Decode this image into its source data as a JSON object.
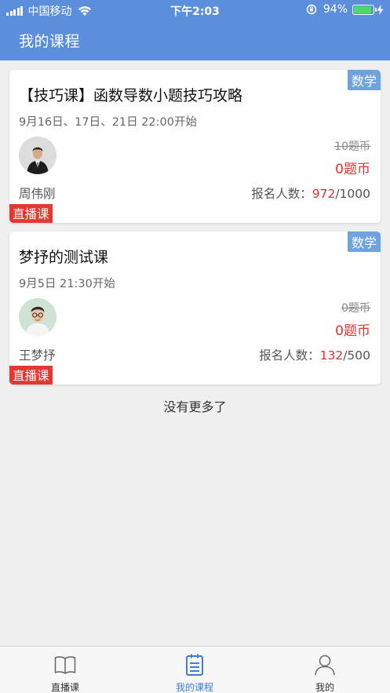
{
  "status_bar": {
    "carrier": "中国移动",
    "time": "下午2:03",
    "battery": "94%"
  },
  "header": {
    "title": "我的课程"
  },
  "courses": [
    {
      "subject": "数学",
      "title": "【技巧课】函数导数小题技巧攻略",
      "time": "9月16日、17日、21日 22:00开始",
      "teacher": "周伟刚",
      "original_price": "10题币",
      "price": "0题币",
      "enroll_label": "报名人数：",
      "enrolled": "972",
      "capacity": "/1000",
      "type": "直播课"
    },
    {
      "subject": "数学",
      "title": "梦抒的测试课",
      "time": "9月5日 21:30开始",
      "teacher": "王梦抒",
      "original_price": "0题币",
      "price": "0题币",
      "enroll_label": "报名人数：",
      "enrolled": "132",
      "capacity": "/500",
      "type": "直播课"
    }
  ],
  "list_footer": "没有更多了",
  "tabbar": {
    "items": [
      {
        "label": "直播课",
        "icon": "book-icon",
        "active": false
      },
      {
        "label": "我的课程",
        "icon": "clipboard-icon",
        "active": true
      },
      {
        "label": "我的",
        "icon": "person-icon",
        "active": false
      }
    ]
  },
  "colors": {
    "header_bg": "#5b8fdc",
    "accent_red": "#e0332b",
    "subject_tag_bg": "#6fa3dd",
    "active_tab": "#3d7fd6"
  }
}
